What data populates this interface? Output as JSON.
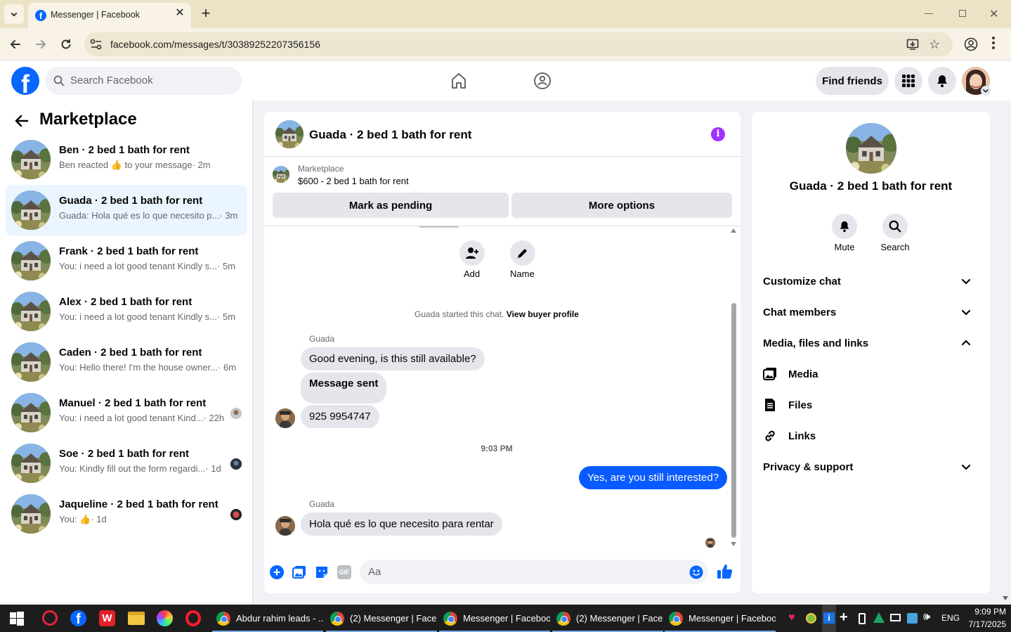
{
  "browser": {
    "tab_title": "Messenger | Facebook",
    "url": "facebook.com/messages/t/30389252207356156"
  },
  "header": {
    "search_placeholder": "Search Facebook",
    "find_friends": "Find friends"
  },
  "sidebar": {
    "title": "Marketplace",
    "conversations": [
      {
        "name": "Ben · 2 bed 1 bath for rent",
        "preview_a": "Ben reacted ",
        "preview_b": " to your message",
        "time": "· 2m",
        "selected": false
      },
      {
        "name": "Guada · 2 bed 1 bath for rent",
        "preview": "Guada: Hola qué es lo que necesito p...",
        "time": "· 3m",
        "selected": true
      },
      {
        "name": "Frank · 2 bed 1 bath for rent",
        "preview": "You: i need a lot good tenant Kindly s...",
        "time": "· 5m",
        "selected": false
      },
      {
        "name": "Alex · 2 bed 1 bath for rent",
        "preview": "You: i need a lot good tenant Kindly s...",
        "time": "· 5m",
        "selected": false
      },
      {
        "name": "Caden · 2 bed 1 bath for rent",
        "preview": "You: Hello there! I'm the house owner...",
        "time": "· 6m",
        "selected": false
      },
      {
        "name": "Manuel · 2 bed 1 bath for rent",
        "preview": "You: i need a lot good tenant Kind...",
        "time": "· 22h",
        "selected": false
      },
      {
        "name": "Soe · 2 bed 1 bath for rent",
        "preview": "You: Kindly fill out the form regardi...",
        "time": "· 1d",
        "selected": false
      },
      {
        "name": "Jaqueline · 2 bed 1 bath for rent",
        "preview": "You: ",
        "time": "· 1d",
        "selected": false
      }
    ]
  },
  "chat": {
    "title": "Guada · 2 bed 1 bath for rent",
    "listing_source": "Marketplace",
    "listing_title": "$600 - 2 bed 1 bath for rent",
    "mark_pending": "Mark as pending",
    "more_options": "More options",
    "add_label": "Add",
    "name_label": "Name",
    "started_text": "Guada started this chat.",
    "view_profile": "View buyer profile",
    "sender_1": "Guada",
    "msg_1": "Good evening, is this still available?",
    "msg_2": "Message sent",
    "msg_3": "925 9954747",
    "timestamp": "9:03 PM",
    "msg_4": "Yes, are you still interested?",
    "sender_2": "Guada",
    "msg_5": "Hola qué es lo que necesito para rentar",
    "composer_placeholder": "Aa"
  },
  "details": {
    "title": "Guada · 2 bed 1 bath for rent",
    "mute": "Mute",
    "search": "Search",
    "customize": "Customize chat",
    "members": "Chat members",
    "media_files_links": "Media, files and links",
    "media": "Media",
    "files": "Files",
    "links": "Links",
    "privacy": "Privacy & support"
  },
  "taskbar": {
    "items": [
      "Abdur rahim leads - ...",
      "(2) Messenger | Face...",
      "Messenger | Faceboo...",
      "(2) Messenger | Face...",
      "Messenger | Faceboo..."
    ],
    "lang": "ENG",
    "time": "9:09 PM",
    "date": "7/17/2025"
  },
  "colors": {
    "fb_blue": "#0866ff",
    "messenger_bubble_out": "#0a5bff",
    "info_purple": "#a033ff",
    "selected_row": "#ebf5ff"
  }
}
